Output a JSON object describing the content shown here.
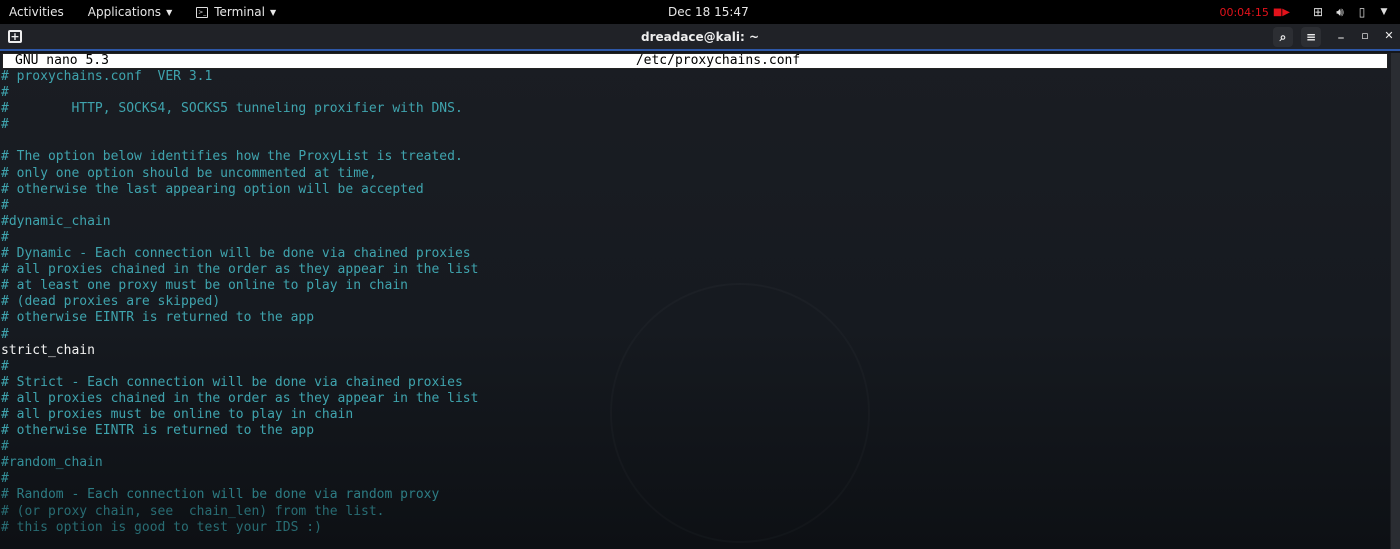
{
  "topbar": {
    "activities": "Activities",
    "applications": "Applications",
    "terminal": "Terminal",
    "clock": "Dec 18  15:47",
    "recording_time": "00:04:15",
    "recording_color": "#e3121b",
    "icons": [
      "network-icon",
      "volume-icon",
      "battery-icon",
      "system-menu-caret-icon"
    ]
  },
  "window": {
    "title": "dreadace@kali: ~",
    "search_label": "⌕",
    "menu_label": "≡",
    "minimize_label": "_",
    "maximize_label": "▫",
    "close_label": "✕"
  },
  "nano": {
    "version": "GNU nano 5.3",
    "filename": "/etc/proxychains.conf",
    "lines": [
      {
        "text": "# proxychains.conf  VER 3.1",
        "style": ""
      },
      {
        "text": "#",
        "style": ""
      },
      {
        "text": "#        HTTP, SOCKS4, SOCKS5 tunneling proxifier with DNS.",
        "style": ""
      },
      {
        "text": "#",
        "style": ""
      },
      {
        "text": "",
        "style": ""
      },
      {
        "text": "# The option below identifies how the ProxyList is treated.",
        "style": ""
      },
      {
        "text": "# only one option should be uncommented at time,",
        "style": ""
      },
      {
        "text": "# otherwise the last appearing option will be accepted",
        "style": ""
      },
      {
        "text": "#",
        "style": ""
      },
      {
        "text": "#dynamic_chain",
        "style": ""
      },
      {
        "text": "#",
        "style": ""
      },
      {
        "text": "# Dynamic - Each connection will be done via chained proxies",
        "style": ""
      },
      {
        "text": "# all proxies chained in the order as they appear in the list",
        "style": ""
      },
      {
        "text": "# at least one proxy must be online to play in chain",
        "style": ""
      },
      {
        "text": "# (dead proxies are skipped)",
        "style": ""
      },
      {
        "text": "# otherwise EINTR is returned to the app",
        "style": ""
      },
      {
        "text": "#",
        "style": ""
      },
      {
        "text": "strict_chain",
        "style": "plain"
      },
      {
        "text": "#",
        "style": ""
      },
      {
        "text": "# Strict - Each connection will be done via chained proxies",
        "style": ""
      },
      {
        "text": "# all proxies chained in the order as they appear in the list",
        "style": ""
      },
      {
        "text": "# all proxies must be online to play in chain",
        "style": ""
      },
      {
        "text": "# otherwise EINTR is returned to the app",
        "style": ""
      },
      {
        "text": "#",
        "style": "fade1"
      },
      {
        "text": "#random_chain",
        "style": "fade1"
      },
      {
        "text": "#",
        "style": "fade1"
      },
      {
        "text": "# Random - Each connection will be done via random proxy",
        "style": "fade2"
      },
      {
        "text": "# (or proxy chain, see  chain_len) from the list.",
        "style": "fade3"
      },
      {
        "text": "# this option is good to test your IDS :)",
        "style": "fade3"
      }
    ]
  }
}
